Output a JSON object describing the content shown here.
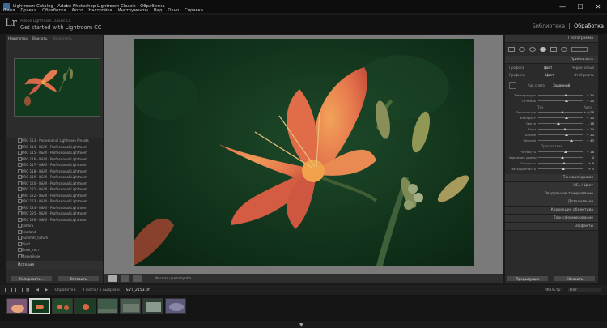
{
  "window": {
    "title": "Lightroom Catalog - Adobe Photoshop Lightroom Classic - Обработка",
    "controls": [
      "—",
      "☐",
      "✕"
    ]
  },
  "menu": [
    "Файл",
    "Правка",
    "Обработка",
    "Фото",
    "Настройки",
    "Инструменты",
    "Вид",
    "Окно",
    "Справка"
  ],
  "identity": {
    "line1": "Adobe Lightroom Classic CC",
    "line2": "Get started with Lightroom CC"
  },
  "modules": {
    "library": "Библиотека",
    "develop": "Обработка",
    "separator": "|"
  },
  "navigator": {
    "title": "Навигатор",
    "zoom1": "Вписать",
    "zoom2": "Заполнить"
  },
  "presets": [
    "PRO 113 - Professional Lightroom Presets",
    "PRO 114 - B&W - Professional Lightroom",
    "PRO 115 - B&W - Professional Lightroom",
    "PRO 116 - B&W - Professional Lightroom",
    "PRO 117 - B&W - Professional Lightroom",
    "PRO 118 - B&W - Professional Lightroom",
    "PRO 119 - B&W - Professional Lightroom",
    "PRO 120 - B&W - Professional Lightroom",
    "PRO 121 - B&W - Professional Lightroom",
    "PRO 122 - B&W - Professional Lightroom",
    "PRO 123 - B&W - Professional Lightroom",
    "PRO 124 - B&W - Professional Lightroom",
    "PRO 125 - B&W - Professional Lightroom",
    "PRO 126 - B&W - Professional Lightroom",
    "Sahara",
    "Scotland",
    "Summer_nature",
    "Vivid",
    "Илья_тест",
    "Москвёнок"
  ],
  "history_label": "История",
  "left_buttons": {
    "copy": "Копировать...",
    "paste": "Вставить"
  },
  "toolbar": {
    "label": "Мягкая цветопроба"
  },
  "right_panel": {
    "histogram": "Гистограмма",
    "edit_section": "Приблизить",
    "profile_row": {
      "label": "Профиль",
      "value": "Цвет",
      "option": "Отобразить"
    },
    "wb_label": "Профиль:",
    "treatment": {
      "color": "Цвет",
      "bw": "Чёрно-белый"
    },
    "wb": {
      "as_shot": "Как снято",
      "custom": "Заданный"
    },
    "sliders": [
      {
        "label": "Температура",
        "value": "+ 24"
      },
      {
        "label": "Оттенок",
        "value": "+ 24"
      },
      {
        "label": "Экспозиция",
        "value": "+ 0,08"
      },
      {
        "label": "Контраст",
        "value": "+ 20"
      },
      {
        "label": "Света",
        "value": "- 18"
      },
      {
        "label": "Тени",
        "value": "+ 14"
      },
      {
        "label": "Белые",
        "value": "+ 20"
      },
      {
        "label": "Чёрные",
        "value": "+ 43"
      }
    ],
    "tone_label": "Тон",
    "auto_label": "Авто",
    "presence_title": "Присутствие",
    "presence_sliders": [
      {
        "label": "Четкость",
        "value": "+ 16"
      },
      {
        "label": "Удаление дымки",
        "value": "0"
      },
      {
        "label": "Сочность",
        "value": "+ 8"
      },
      {
        "label": "Насыщенность",
        "value": "+ 3"
      }
    ],
    "collapsed": [
      "Тоновая кривая",
      "HSL / Цвет",
      "Раздельное тонирование",
      "Детализация",
      "Коррекция объектива",
      "Трансформирование",
      "Эффекты"
    ],
    "buttons": {
      "previous": "Предыдущие",
      "reset": "Сбросить"
    }
  },
  "filmstrip": {
    "nav": "Обработка",
    "info": "8 фото / 1 выбрано",
    "file": "SVT_2153.tif",
    "filter": "Фильтр:",
    "filter_value": "Нет",
    "thumb_count": 8
  }
}
